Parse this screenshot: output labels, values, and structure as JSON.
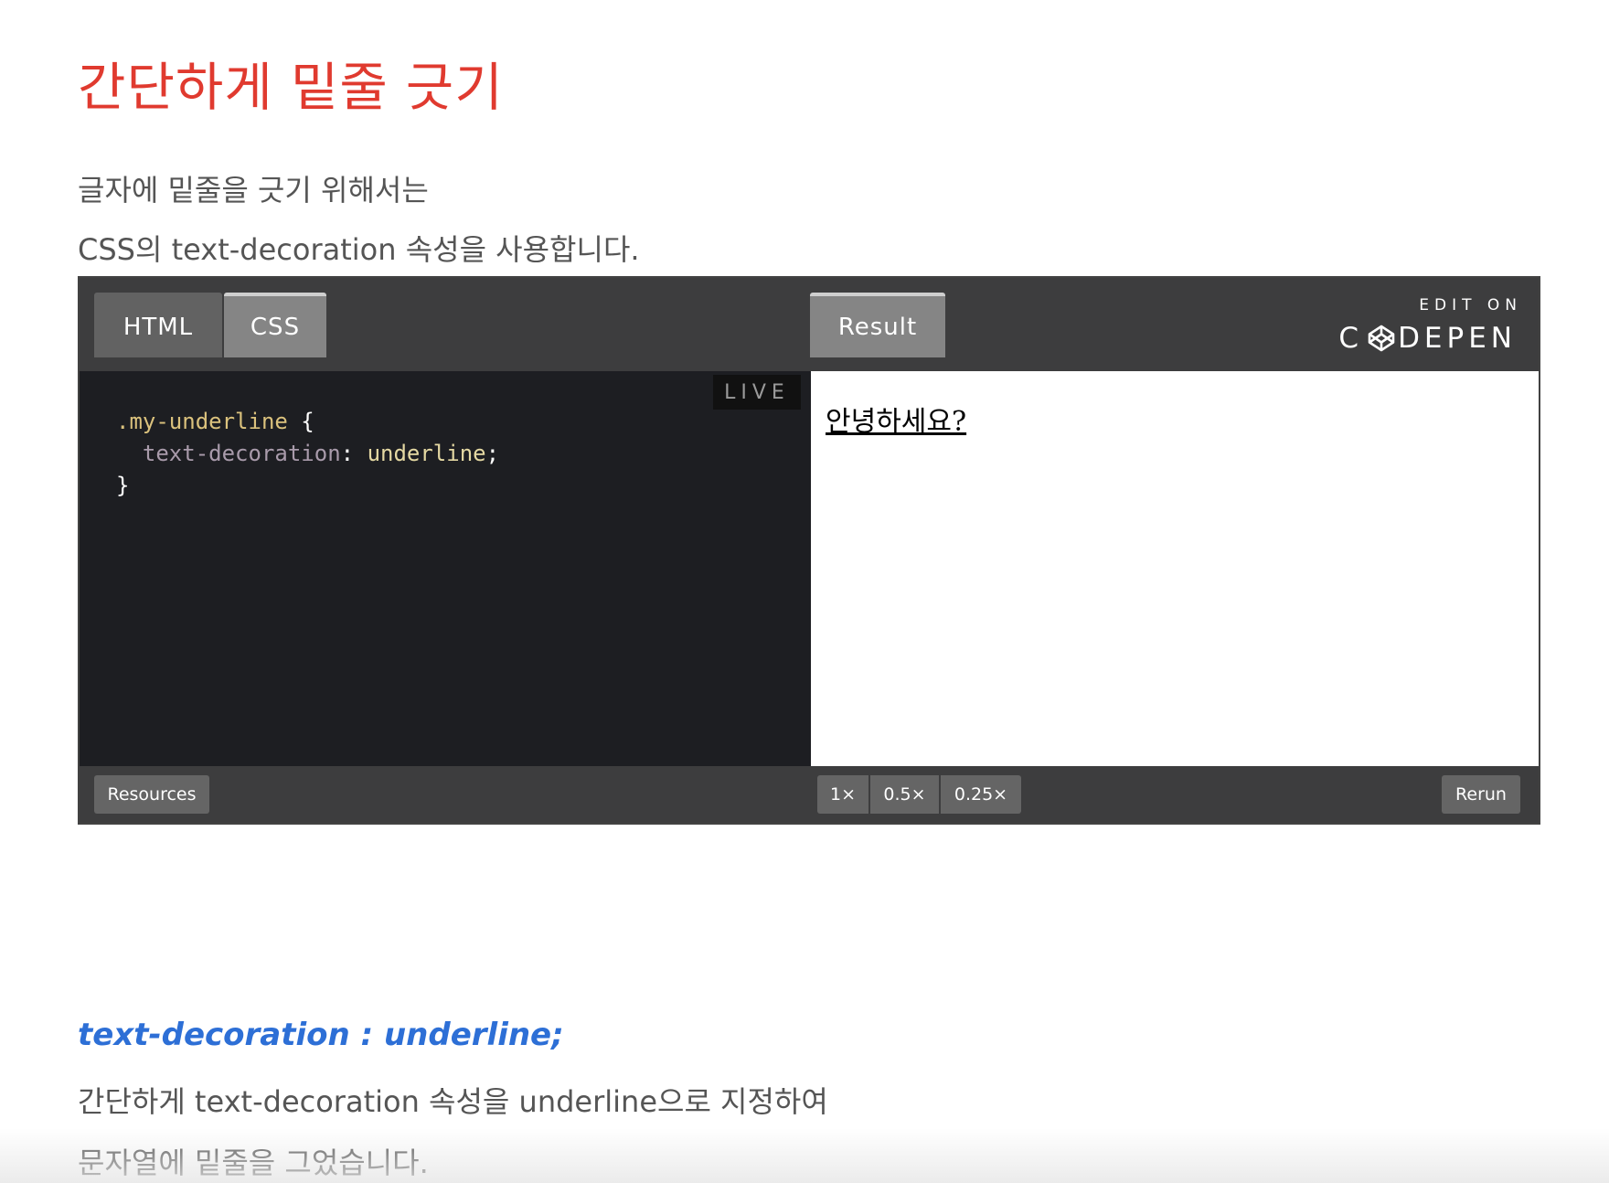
{
  "article": {
    "title": "간단하게 밑줄 긋기",
    "intro_line1": "글자에 밑줄을 긋기 위해서는",
    "intro_line2": "CSS의 text-decoration 속성을 사용합니다.",
    "subheading": "text-decoration : underline;",
    "outro_line1": "간단하게 text-decoration 속성을 underline으로 지정하여",
    "outro_line2": "문자열에 밑줄을 그었습니다."
  },
  "embed": {
    "tabs": {
      "html": "HTML",
      "css": "CSS",
      "result": "Result"
    },
    "active_tab": "CSS",
    "edit_on_label": "EDIT ON",
    "brand_label_left": "C",
    "brand_label_right": "DEPEN",
    "live_badge": "LIVE",
    "code": {
      "selector": ".my-underline",
      "open_brace": "{",
      "property": "text-decoration",
      "colon": ":",
      "value": "underline",
      "semicolon": ";",
      "close_brace": "}"
    },
    "result_text": "안녕하세요?",
    "footer": {
      "resources": "Resources",
      "zoom_options": [
        "1×",
        "0.5×",
        "0.25×"
      ],
      "rerun": "Rerun"
    }
  },
  "colors": {
    "title": "#e03a2f",
    "subheading": "#2d6fd6",
    "body_text": "#555555",
    "embed_header": "#3d3d3e",
    "code_bg": "#1d1e22"
  },
  "icons": {
    "brand": "codepen-cube-icon"
  }
}
